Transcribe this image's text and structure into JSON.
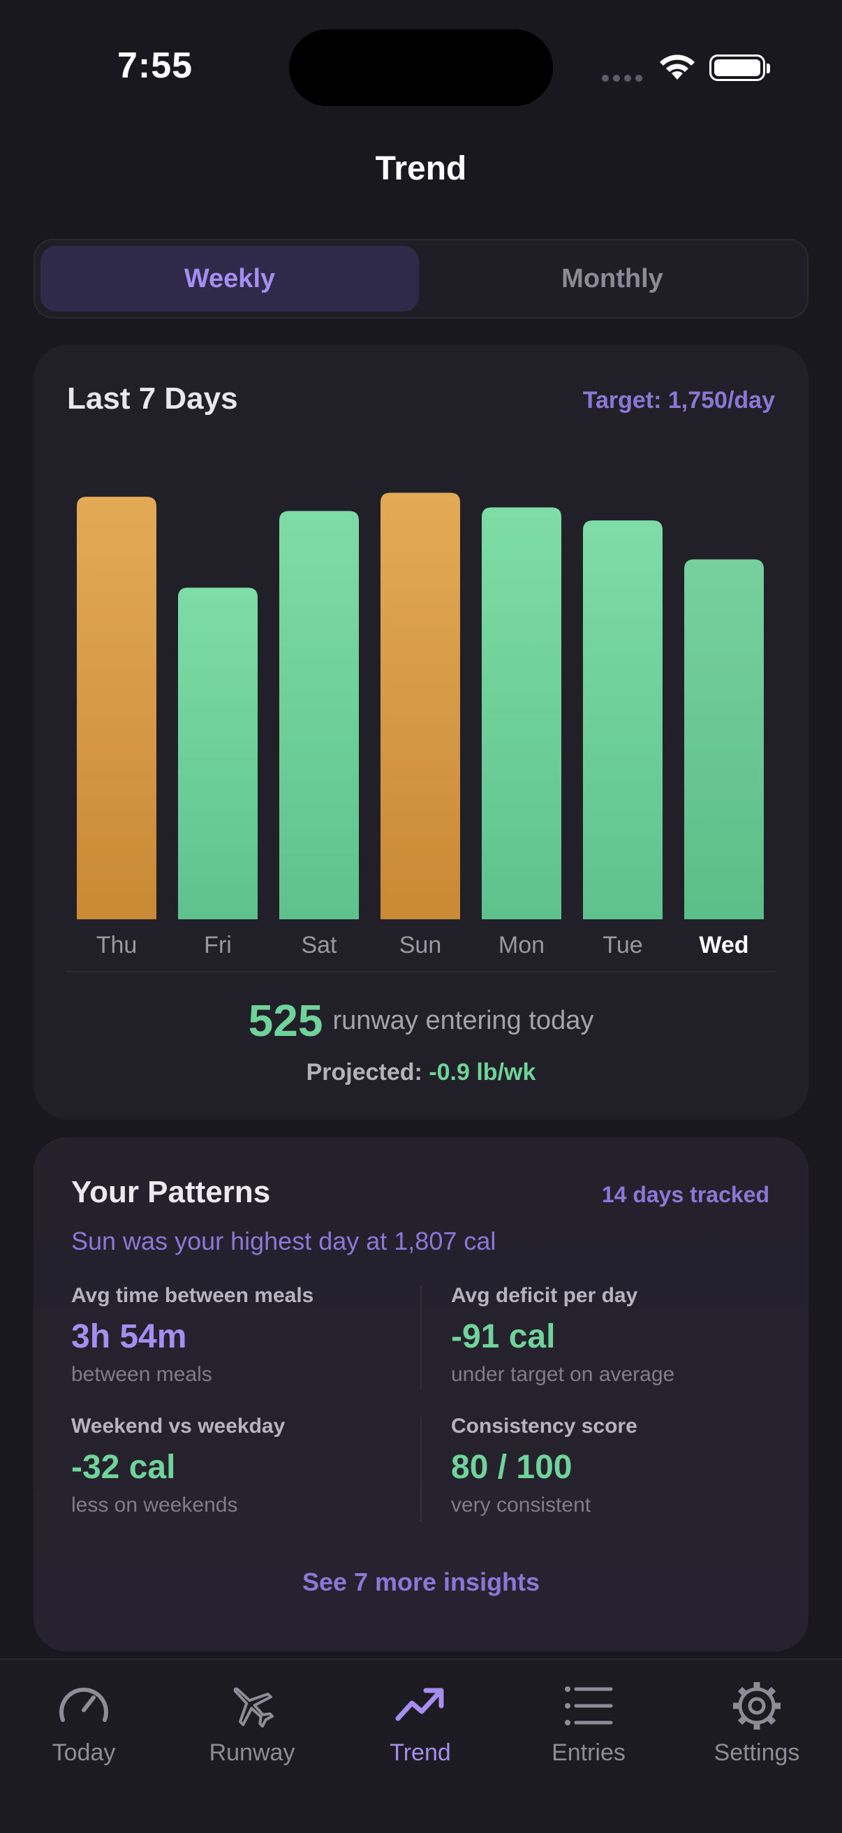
{
  "status_bar": {
    "time": "7:55"
  },
  "header": {
    "title": "Trend"
  },
  "segmented": {
    "weekly": "Weekly",
    "monthly": "Monthly",
    "selected": "Weekly"
  },
  "chart_card": {
    "title": "Last 7 Days",
    "target": "Target: 1,750/day",
    "runway_number": "525",
    "runway_text": "runway entering today",
    "projected_label": "Projected:",
    "projected_value": "-0.9 lb/wk"
  },
  "chart_data": {
    "type": "bar",
    "categories": [
      "Thu",
      "Fri",
      "Sat",
      "Sun",
      "Mon",
      "Tue",
      "Wed"
    ],
    "values": [
      1790,
      1405,
      1730,
      1807,
      1745,
      1690,
      1525
    ],
    "status": [
      "over",
      "under",
      "under",
      "over",
      "under",
      "under",
      "under"
    ],
    "current_day": "Wed",
    "colors": {
      "over": "#e3aa54",
      "under": "#76d8a0",
      "today": "#72cf98"
    },
    "ylim": [
      0,
      1900
    ]
  },
  "patterns": {
    "title": "Your Patterns",
    "tracked": "14 days tracked",
    "highlight": "Sun was your highest day at 1,807 cal",
    "stats": [
      {
        "label": "Avg time between meals",
        "value": "3h 54m",
        "sub": "between meals"
      },
      {
        "label": "Avg deficit per day",
        "value": "-91 cal",
        "sub": "under target on average"
      },
      {
        "label": "Weekend vs weekday",
        "value": "-32 cal",
        "sub": "less on weekends"
      },
      {
        "label": "Consistency score",
        "value": "80 / 100",
        "sub": "very consistent"
      }
    ],
    "more_link": "See 7 more insights"
  },
  "tab_bar": {
    "items": [
      {
        "label": "Today",
        "icon": "gauge-icon"
      },
      {
        "label": "Runway",
        "icon": "airplane-icon"
      },
      {
        "label": "Trend",
        "icon": "trend-arrow-icon"
      },
      {
        "label": "Entries",
        "icon": "list-icon"
      },
      {
        "label": "Settings",
        "icon": "gear-icon"
      }
    ],
    "active": "Trend"
  }
}
